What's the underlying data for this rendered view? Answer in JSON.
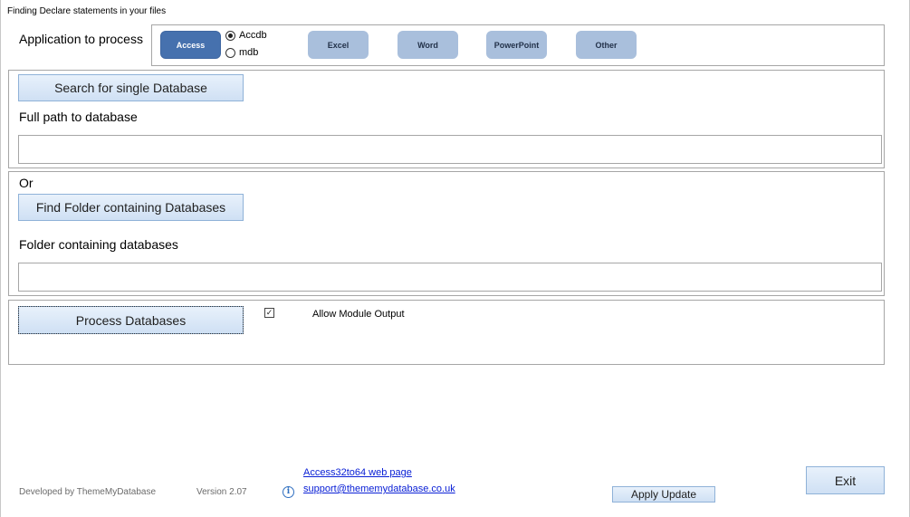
{
  "window": {
    "title": "Finding Declare statements in your files"
  },
  "app_section": {
    "label": "Application  to process",
    "buttons": [
      {
        "label": "Access",
        "active": true
      },
      {
        "label": "Excel",
        "active": false
      },
      {
        "label": "Word",
        "active": false
      },
      {
        "label": "PowerPoint",
        "active": false
      },
      {
        "label": "Other",
        "active": false
      }
    ],
    "format_options": [
      {
        "label": "Accdb",
        "selected": true
      },
      {
        "label": "mdb",
        "selected": false
      }
    ]
  },
  "single_db": {
    "search_button": "Search for single Database",
    "path_label": "Full path to database",
    "path_value": ""
  },
  "folder": {
    "or_label": "Or",
    "find_button": "Find Folder containing Databases",
    "folder_label": "Folder containing databases",
    "folder_value": ""
  },
  "process": {
    "button": "Process Databases",
    "allow_module_output_label": "Allow Module Output",
    "allow_module_output_checked": true
  },
  "footer": {
    "developed_by": "Developed by ThemeMyDatabase",
    "version": "Version 2.07",
    "web_link": "Access32to64 web page",
    "support_link": "support@thememydatabase.co.uk",
    "apply_update": "Apply Update",
    "exit": "Exit"
  },
  "colors": {
    "active_button": "#4671ae",
    "inactive_button": "#a9bfdc",
    "link": "#0a20d6",
    "button_border": "#8fb2d8"
  },
  "icons": {
    "info": "info-icon"
  }
}
